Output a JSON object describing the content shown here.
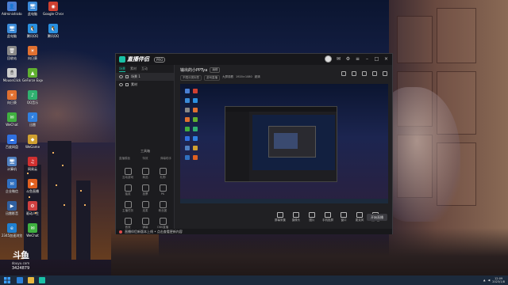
{
  "desktop": {
    "icons": [
      {
        "label": "Administrato...",
        "color": "#4a7fd4",
        "glyph": "👤"
      },
      {
        "label": "此电脑",
        "color": "#3a8ad8",
        "glyph": "🖥"
      },
      {
        "label": "回收站",
        "color": "#888888",
        "glyph": "🗑"
      },
      {
        "label": "MouseClick",
        "color": "#cccccc",
        "glyph": "🖱"
      },
      {
        "label": "向日葵",
        "color": "#e07030",
        "glyph": "☀"
      },
      {
        "label": "WeChat",
        "color": "#40b040",
        "glyph": "✉"
      },
      {
        "label": "Google Chrome",
        "color": "#d04030",
        "glyph": "◉"
      },
      {
        "label": "腾讯QQ",
        "color": "#2a90e0",
        "glyph": "🐧"
      },
      {
        "label": "GeForce Experience",
        "color": "#60b030",
        "glyph": "▲"
      },
      {
        "label": "QQ音乐",
        "color": "#30b070",
        "glyph": "♪"
      },
      {
        "label": "百度网盘",
        "color": "#3070e0",
        "glyph": "☁"
      },
      {
        "label": "迅雷",
        "color": "#3080e0",
        "glyph": "⚡"
      },
      {
        "label": "计算机",
        "color": "#5080c0",
        "glyph": "🖥"
      },
      {
        "label": "WeGame",
        "color": "#d0a030",
        "glyph": "◆"
      },
      {
        "label": "网易云",
        "color": "#d03030",
        "glyph": "♫"
      },
      {
        "label": "企业微信",
        "color": "#3070c0",
        "glyph": "✉"
      },
      {
        "label": "斗鱼直播",
        "color": "#e06020",
        "glyph": "▶"
      },
      {
        "label": "迅雷影音",
        "color": "#3060a0",
        "glyph": "▶"
      },
      {
        "label": "2345加速浏览器",
        "color": "#2080d0",
        "glyph": "e"
      },
      {
        "label": "驱动人生",
        "color": "#d04040",
        "glyph": "⚙"
      }
    ]
  },
  "counter": {
    "logo": "斗鱼",
    "logo_sub": "douyu.com",
    "number": "3424879"
  },
  "app": {
    "logo_text": "直播伴侣",
    "version": "PRO",
    "sidebar_tabs": [
      "场景",
      "素材",
      "互动"
    ],
    "scenes": [
      "场景 1",
      "素材"
    ],
    "tools_title": "工具箱",
    "tools_sub": [
      "直播模板",
      "特效",
      "弹幕助手"
    ],
    "tools": [
      "互动游戏",
      "商品",
      "礼物",
      "抽奖",
      "投票",
      "PK",
      "主播任务",
      "连麦",
      "粉丝团",
      "音效",
      "弹幕",
      "OBS直播"
    ],
    "stream_title": "输出的小PPTya",
    "stream_title_edit": "编辑",
    "stream_meta": [
      "不限分类标签",
      "游戏直播",
      "大屏观看",
      "1920×1080",
      "超清"
    ],
    "bottom_tools": [
      "屏幕采集",
      "摄像头",
      "图片",
      "手机投屏",
      "窗口",
      "麦克风",
      "扬声器"
    ],
    "go_live": "开始直播",
    "notice": "直播伴侣新版本上线 • 点击查看更新内容"
  },
  "taskbar": {
    "time": "12:09",
    "date": "2023/1/8"
  }
}
